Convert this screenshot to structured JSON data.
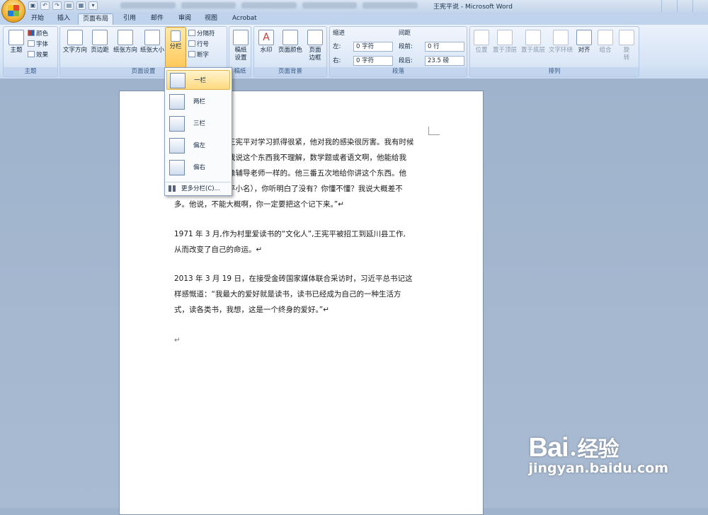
{
  "window": {
    "title": "王宪平说 - Microsoft Word"
  },
  "qat": {
    "save": "▣",
    "undo": "↶",
    "redo": "↷",
    "open": "▤",
    "print": "▦",
    "more": "▾"
  },
  "tabs": [
    "开始",
    "插入",
    "页面布局",
    "引用",
    "邮件",
    "审阅",
    "视图",
    "Acrobat"
  ],
  "ribbon": {
    "theme": {
      "label": "主题",
      "colors": "颜色",
      "fonts": "字体",
      "effects": "效果",
      "group": "主题"
    },
    "page_setup": {
      "text_direction": "文字方向",
      "margins": "页边距",
      "orientation": "纸张方向",
      "size": "纸张大小",
      "columns": "分栏",
      "breaks": "分隔符",
      "line_numbers": "行号",
      "hyphenation": "断字",
      "group": "页面设置"
    },
    "draft": {
      "label": "稿纸\n设置",
      "group": "稿纸"
    },
    "background": {
      "watermark": "水印",
      "page_color": "页面颜色",
      "page_borders": "页面\n边框",
      "group": "页面背景"
    },
    "paragraph": {
      "indent": "缩进",
      "spacing": "间距",
      "left": "左:",
      "right": "右:",
      "before": "段前:",
      "after": "段后:",
      "left_val": "0 字符",
      "right_val": "0 字符",
      "before_val": "0 行",
      "after_val": "23.5 磅",
      "group": "段落"
    },
    "arrange": {
      "position": "位置",
      "front": "置于顶层",
      "back": "置于底层",
      "wrap": "文字环绕",
      "align": "对齐",
      "group_btn": "组合",
      "rotate": "旋\n转",
      "group": "排列"
    }
  },
  "columns_menu": {
    "items": [
      "一栏",
      "两栏",
      "三栏",
      "偏左",
      "偏右"
    ],
    "more": "更多分栏(C)..."
  },
  "document": {
    "p1_lines": [
      "王宪平对学习抓得很紧，他对我的感染很厉害。我有时候",
      "我说这个东西我不理解，数学题或者语文啊，他能给我",
      "像辅导老师一样的。他三番五次地给你讲这个东西。他",
      "平小名），你听明白了没有？你懂不懂？我说大概差不",
      "多。他说，不能大概啊，你一定要把这个记下来。”↵"
    ],
    "p2_lines": [
      "1971 年 3 月,作为村里爱读书的“文化人”,王宪平被招工到延川县工作,",
      "从而改变了自己的命运。↵"
    ],
    "p3_lines": [
      "2013 年 3 月 19 日，在接受金砖国家媒体联合采访时，习近平总书记这",
      "样感慨道：“我最大的爱好就是读书，读书已经成为自己的一种生活方",
      "式，读各类书，我想，这是一个终身的爱好。”↵"
    ],
    "p4": "↵"
  },
  "watermark": {
    "brand": "Bai",
    "brand_cn": "经验",
    "url": "jingyan.baidu.com"
  }
}
